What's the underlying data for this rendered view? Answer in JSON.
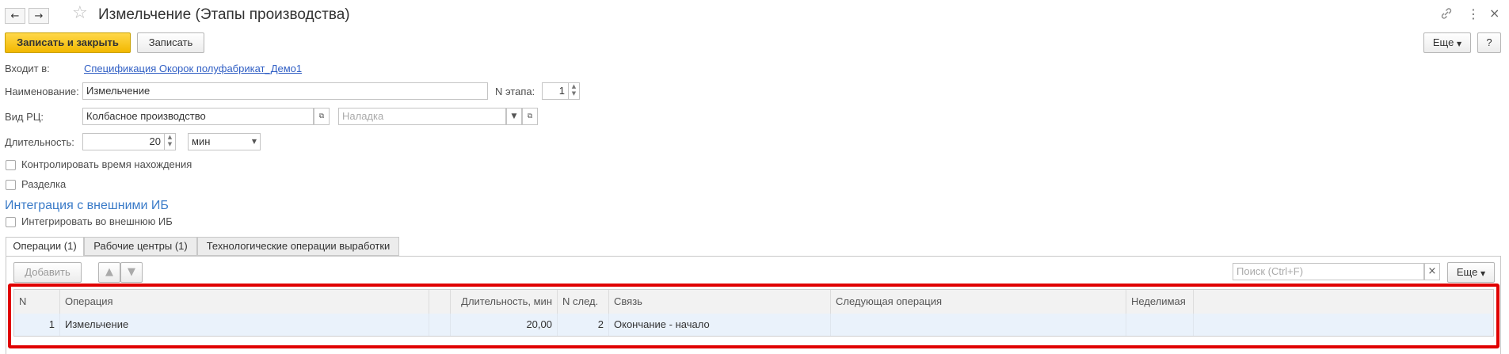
{
  "window": {
    "title": "Измельчение (Этапы производства)",
    "back_icon": "←",
    "forward_icon": "→",
    "star_icon": "☆",
    "link_icon": "🔗",
    "menu_icon": "⋮",
    "close_icon": "×"
  },
  "toolbar": {
    "save_close_label": "Записать и закрыть",
    "save_label": "Записать",
    "more_label": "Еще",
    "help_label": "?"
  },
  "form": {
    "part_of_label": "Входит в:",
    "part_of_value": "Спецификация Окорок полуфабрикат_Демо1",
    "name_label": "Наименование:",
    "name_value": "Измельчение",
    "stage_no_label": "N этапа:",
    "stage_no_value": "1",
    "wc_type_label": "Вид РЦ:",
    "wc_type_value": "Колбасное производство",
    "setup_placeholder": "Наладка",
    "duration_label": "Длительность:",
    "duration_value": "20",
    "duration_unit": "мин",
    "control_time_label": "Контролировать время нахождения",
    "cutting_label": "Разделка"
  },
  "integration": {
    "heading": "Интеграция с внешними ИБ",
    "integrate_label": "Интегрировать во внешнюю ИБ"
  },
  "tabs": [
    {
      "label": "Операции (1)"
    },
    {
      "label": "Рабочие центры (1)"
    },
    {
      "label": "Технологические операции выработки"
    }
  ],
  "table_toolbar": {
    "add_label": "Добавить",
    "up_icon": "🡅",
    "down_icon": "🡇",
    "search_placeholder": "Поиск (Ctrl+F)",
    "clear_icon": "×",
    "more_label": "Еще"
  },
  "table": {
    "columns": [
      "N",
      "Операция",
      "",
      "Длительность, мин",
      "N след.",
      "Связь",
      "Следующая операция",
      "Неделимая"
    ],
    "rows": [
      {
        "n": "1",
        "operation": "Измельчение",
        "duration": "20,00",
        "next_n": "2",
        "link": "Окончание - начало",
        "next_op": "",
        "indivisible": ""
      }
    ]
  },
  "colors": {
    "accent": "#f2b800",
    "highlight_border": "#e00000",
    "selected_row": "#eaf2fb",
    "link": "#2f5ec4"
  }
}
